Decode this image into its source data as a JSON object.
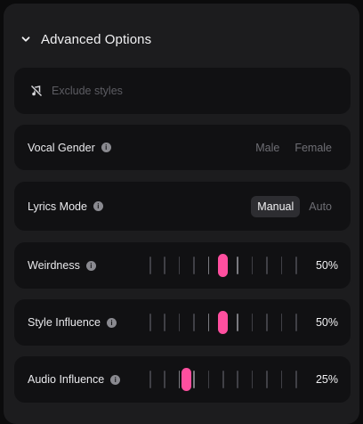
{
  "header": {
    "title": "Advanced Options"
  },
  "exclude": {
    "placeholder": "Exclude styles"
  },
  "vocal_gender": {
    "label": "Vocal Gender",
    "options": [
      "Male",
      "Female"
    ]
  },
  "lyrics_mode": {
    "label": "Lyrics Mode",
    "options": [
      "Manual",
      "Auto"
    ],
    "selected": "Manual"
  },
  "sliders": [
    {
      "label": "Weirdness",
      "value_text": "50%",
      "value": 0.5
    },
    {
      "label": "Style Influence",
      "value_text": "50%",
      "value": 0.5
    },
    {
      "label": "Audio Influence",
      "value_text": "25%",
      "value": 0.25
    }
  ],
  "colors": {
    "accent": "#ff4f9f",
    "panel": "#1c1c1e",
    "card": "#111113"
  },
  "icons": {
    "header": "chevron-down-icon",
    "exclude": "no-music-icon",
    "info": "info-icon"
  }
}
